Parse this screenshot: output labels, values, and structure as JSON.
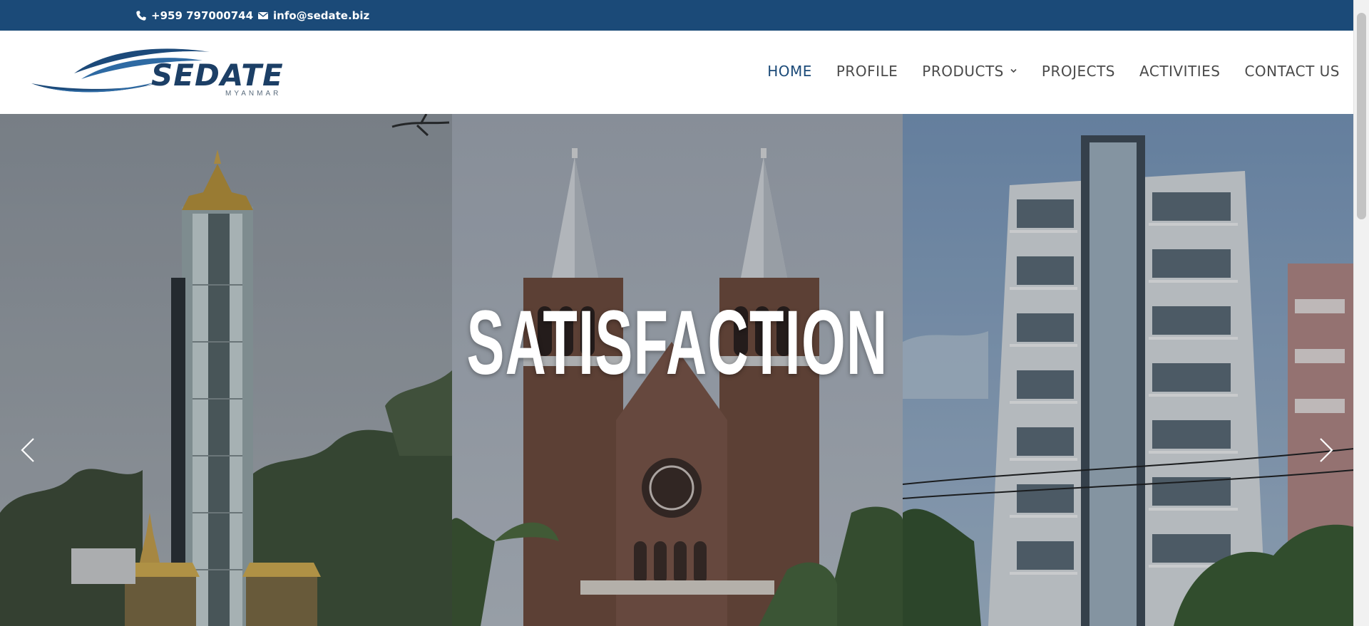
{
  "topbar": {
    "phone": "+959 797000744",
    "email": "info@sedate.biz",
    "phone_icon": "phone-icon",
    "email_icon": "envelope-icon",
    "background_color": "#1b4a78"
  },
  "logo": {
    "name": "SEDATE",
    "tagline": "MYANMAR",
    "icon": "swoosh-logo-icon",
    "color": "#1c3f66"
  },
  "nav": {
    "items": [
      {
        "label": "HOME",
        "active": true
      },
      {
        "label": "PROFILE"
      },
      {
        "label": "PRODUCTS",
        "has_dropdown": true,
        "icon": "chevron-down-icon"
      },
      {
        "label": "PROJECTS"
      },
      {
        "label": "ACTIVITIES"
      },
      {
        "label": "CONTACT US"
      }
    ],
    "active_color": "#1b4a78",
    "text_color": "#4a4a4a"
  },
  "slider": {
    "headline": "SATISFACTION",
    "prev_icon": "chevron-left-icon",
    "next_icon": "chevron-right-icon"
  }
}
